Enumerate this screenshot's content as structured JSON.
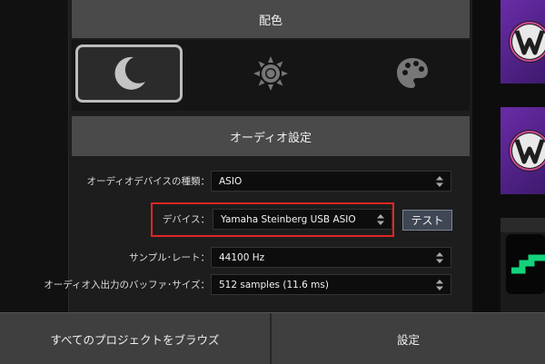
{
  "panel": {
    "color_header": "配色",
    "themes": [
      {
        "name": "moon-icon",
        "selected": true
      },
      {
        "name": "sun-icon",
        "selected": false
      },
      {
        "name": "palette-icon",
        "selected": false
      }
    ],
    "audio_header": "オーディオ設定",
    "audio_rows": {
      "device_type": {
        "label": "オーディオデバイスの種類：",
        "value": "ASIO"
      },
      "device": {
        "label": "デバイス：",
        "value": "Yamaha Steinberg USB ASIO"
      },
      "test_label": "テスト",
      "sample_rate": {
        "label": "サンプル･レート：",
        "value": "44100 Hz"
      },
      "buffer_size": {
        "label": "オーディオ入出力のバッファ･サイズ：",
        "value": "512 samples (11.6 ms)"
      }
    }
  },
  "bottom_bar": {
    "browse_label": "すべてのプロジェクトをブラウズ",
    "settings_label": "設定"
  },
  "colors": {
    "highlight": "#e02525",
    "thumb_purple": "#6a2ca8",
    "thumb_accent": "#12d37a"
  }
}
